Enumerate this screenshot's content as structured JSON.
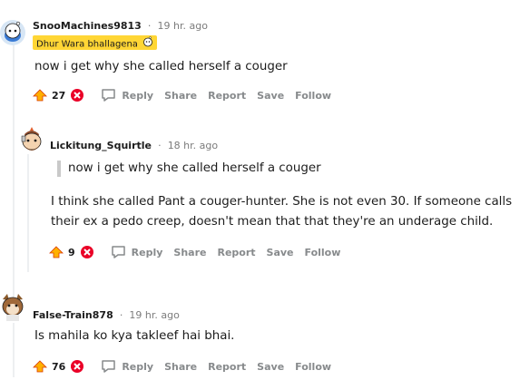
{
  "comments": [
    {
      "username": "SnooMachines9813",
      "time": "19 hr. ago",
      "flair": "Dhur Wara bhallagena",
      "body": "now i get why she called herself a couger",
      "score": "27"
    },
    {
      "username": "Lickitung_Squirtle",
      "time": "18 hr. ago",
      "quote": "now i get why she called herself a couger",
      "body_line1": "I think she called Pant a couger-hunter. She is not even 30. If someone calls",
      "body_line2": "their ex a pedo creep, doesn't mean that that they're an underage child.",
      "score": "9"
    },
    {
      "username": "False-Train878",
      "time": "19 hr. ago",
      "body": "Is mahila ko kya takleef hai bhai.",
      "score": "76"
    }
  ],
  "actions": {
    "reply": "Reply",
    "share": "Share",
    "report": "Report",
    "save": "Save",
    "follow": "Follow"
  },
  "separator": "·",
  "colors": {
    "upvote": "#ff4500",
    "downvote": "#ea0027",
    "flair_bg": "#ffd635",
    "muted": "#878a8c"
  }
}
